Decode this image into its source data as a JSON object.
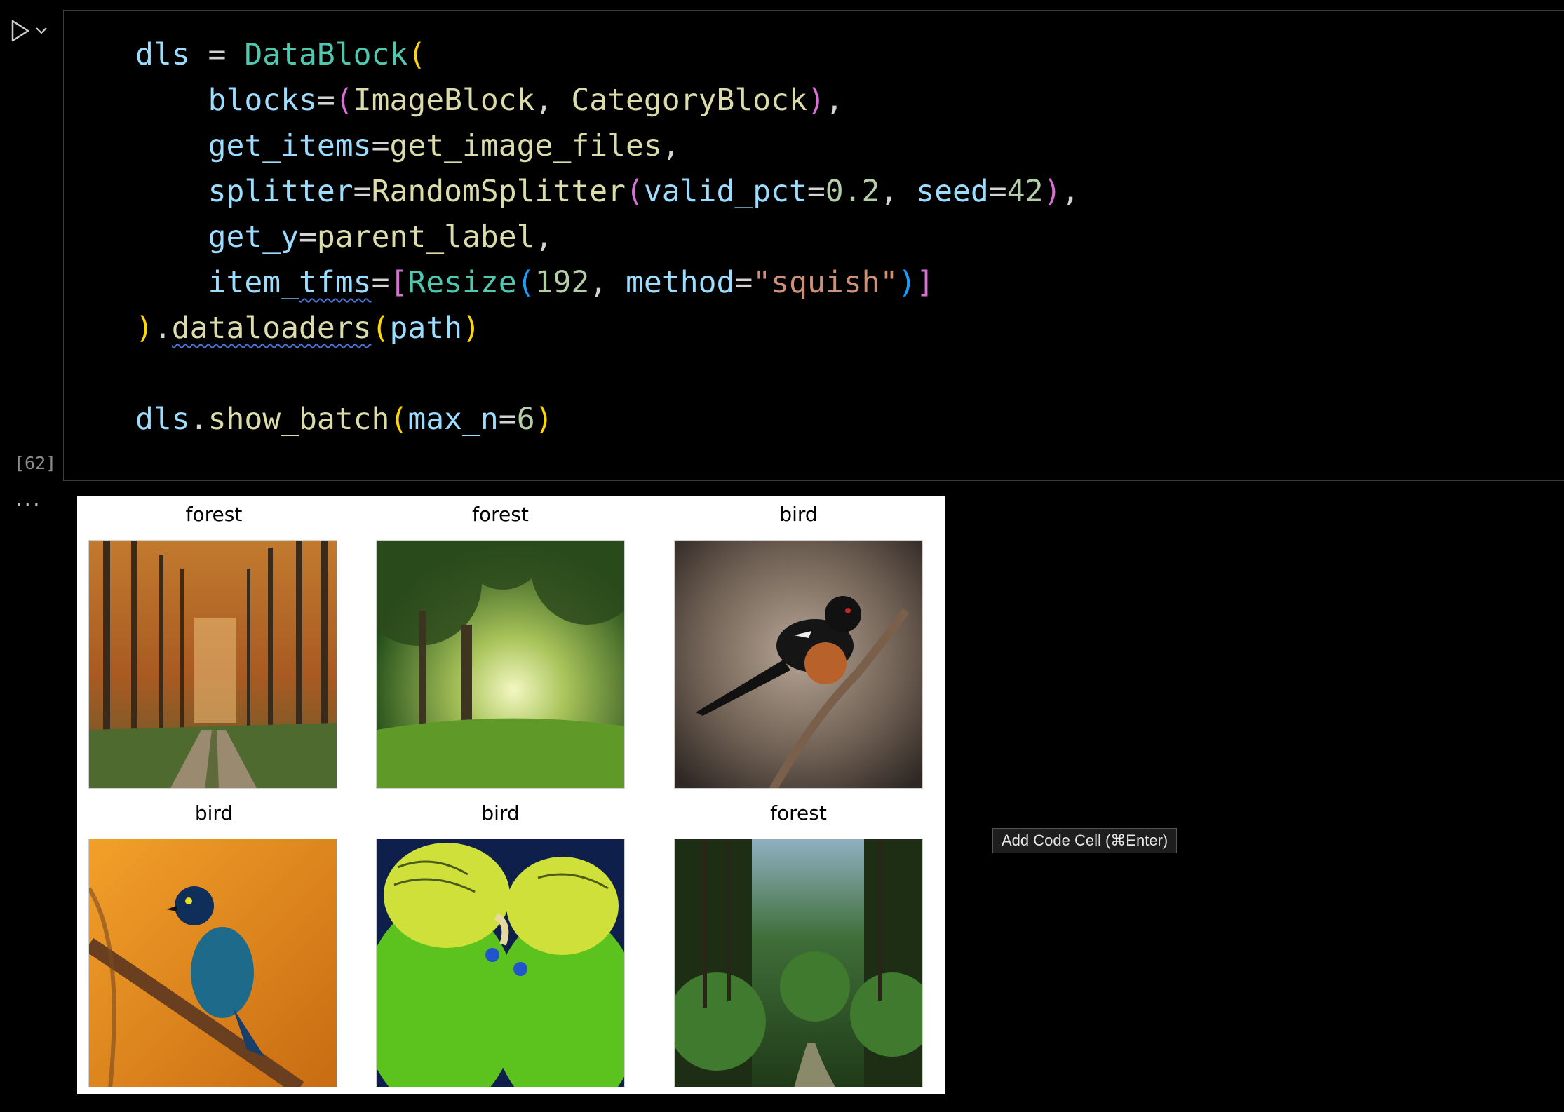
{
  "cell": {
    "execution_count": "[62]",
    "code_lines": [
      "dls = DataBlock(",
      "    blocks=(ImageBlock, CategoryBlock),",
      "    get_items=get_image_files,",
      "    splitter=RandomSplitter(valid_pct=0.2, seed=42),",
      "    get_y=parent_label,",
      "    item_tfms=[Resize(192, method=\"squish\")]",
      ").dataloaders(path)",
      "",
      "dls.show_batch(max_n=6)"
    ]
  },
  "output": {
    "more_icon": "ellipsis-icon",
    "panels": [
      {
        "label": "forest",
        "image": "autumn forest path"
      },
      {
        "label": "forest",
        "image": "sunlit green forest"
      },
      {
        "label": "bird",
        "image": "towhee bird on branch"
      },
      {
        "label": "bird",
        "image": "glossy starling on branch"
      },
      {
        "label": "bird",
        "image": "two budgerigars"
      },
      {
        "label": "forest",
        "image": "dense green forest path"
      }
    ]
  },
  "tooltip": {
    "text": "Add Code Cell (⌘Enter)"
  },
  "toolbar": {
    "run_icon": "run-icon",
    "run_menu_icon": "chevron-down-icon"
  },
  "colors": {
    "background": "#000000",
    "keyword_class": "#4ec9b0",
    "variable": "#9cdcfe",
    "string": "#ce9178",
    "number": "#b5cea8"
  }
}
